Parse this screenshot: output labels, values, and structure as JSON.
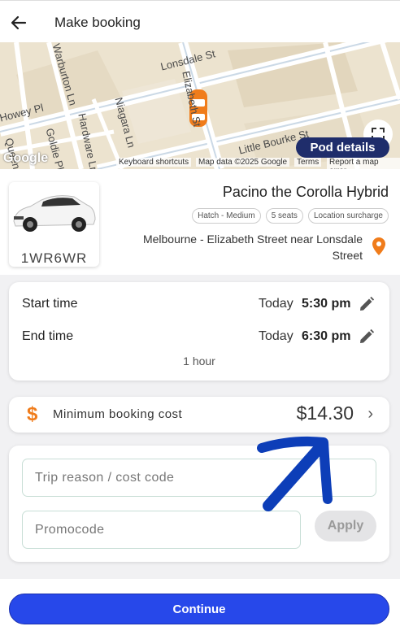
{
  "header": {
    "title": "Make booking",
    "back_icon": "arrow-left-icon"
  },
  "map": {
    "streets": [
      "Lonsdale St",
      "Elizabeth St",
      "Little Bourke St",
      "Niagara Ln",
      "Hardware Ln",
      "Goldie Pl",
      "Queen St",
      "Howey Pl",
      "Warburton Ln"
    ],
    "pod_details_label": "Pod details",
    "attribution": {
      "logo": "Google",
      "shortcuts": "Keyboard shortcuts",
      "map_data": "Map data ©2025 Google",
      "terms": "Terms",
      "report": "Report a map error"
    },
    "car_marker_color": "#f07c1b"
  },
  "car": {
    "plate": "1WR6WR",
    "name": "Pacino the Corolla Hybrid",
    "tags": [
      "Hatch - Medium",
      "5 seats",
      "Location surcharge"
    ],
    "location": "Melbourne - Elizabeth Street near Lonsdale Street",
    "pin_color": "#f07c1b"
  },
  "times": {
    "start": {
      "label": "Start time",
      "day": "Today",
      "time": "5:30 pm"
    },
    "end": {
      "label": "End time",
      "day": "Today",
      "time": "6:30 pm"
    },
    "duration": "1 hour"
  },
  "cost": {
    "label": "Minimum booking cost",
    "value": "$14.30",
    "icon": "dollar-icon"
  },
  "form": {
    "trip_placeholder": "Trip reason / cost code",
    "promo_placeholder": "Promocode",
    "apply_label": "Apply"
  },
  "annotation_arrow_color": "#0d3eb8",
  "continue_label": "Continue",
  "accent_color": "#2748ea"
}
